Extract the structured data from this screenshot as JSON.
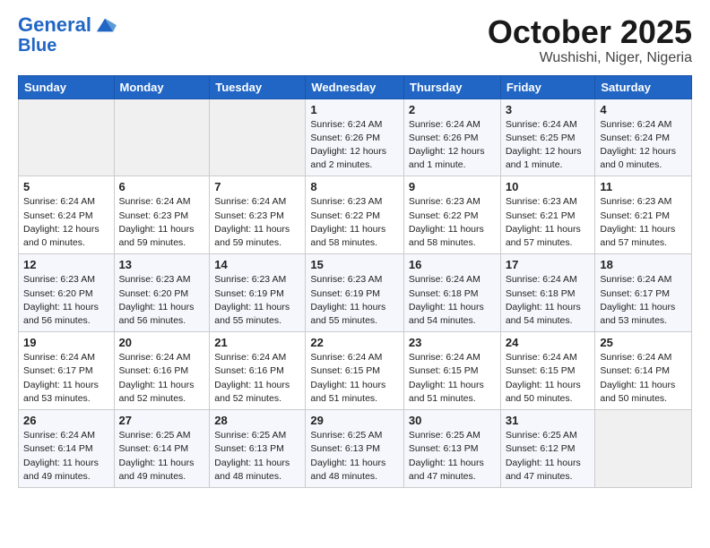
{
  "header": {
    "logo_line1": "General",
    "logo_line2": "Blue",
    "month_title": "October 2025",
    "location": "Wushishi, Niger, Nigeria"
  },
  "days_of_week": [
    "Sunday",
    "Monday",
    "Tuesday",
    "Wednesday",
    "Thursday",
    "Friday",
    "Saturday"
  ],
  "weeks": [
    [
      {
        "day": "",
        "info": ""
      },
      {
        "day": "",
        "info": ""
      },
      {
        "day": "",
        "info": ""
      },
      {
        "day": "1",
        "info": "Sunrise: 6:24 AM\nSunset: 6:26 PM\nDaylight: 12 hours\nand 2 minutes."
      },
      {
        "day": "2",
        "info": "Sunrise: 6:24 AM\nSunset: 6:26 PM\nDaylight: 12 hours\nand 1 minute."
      },
      {
        "day": "3",
        "info": "Sunrise: 6:24 AM\nSunset: 6:25 PM\nDaylight: 12 hours\nand 1 minute."
      },
      {
        "day": "4",
        "info": "Sunrise: 6:24 AM\nSunset: 6:24 PM\nDaylight: 12 hours\nand 0 minutes."
      }
    ],
    [
      {
        "day": "5",
        "info": "Sunrise: 6:24 AM\nSunset: 6:24 PM\nDaylight: 12 hours\nand 0 minutes."
      },
      {
        "day": "6",
        "info": "Sunrise: 6:24 AM\nSunset: 6:23 PM\nDaylight: 11 hours\nand 59 minutes."
      },
      {
        "day": "7",
        "info": "Sunrise: 6:24 AM\nSunset: 6:23 PM\nDaylight: 11 hours\nand 59 minutes."
      },
      {
        "day": "8",
        "info": "Sunrise: 6:23 AM\nSunset: 6:22 PM\nDaylight: 11 hours\nand 58 minutes."
      },
      {
        "day": "9",
        "info": "Sunrise: 6:23 AM\nSunset: 6:22 PM\nDaylight: 11 hours\nand 58 minutes."
      },
      {
        "day": "10",
        "info": "Sunrise: 6:23 AM\nSunset: 6:21 PM\nDaylight: 11 hours\nand 57 minutes."
      },
      {
        "day": "11",
        "info": "Sunrise: 6:23 AM\nSunset: 6:21 PM\nDaylight: 11 hours\nand 57 minutes."
      }
    ],
    [
      {
        "day": "12",
        "info": "Sunrise: 6:23 AM\nSunset: 6:20 PM\nDaylight: 11 hours\nand 56 minutes."
      },
      {
        "day": "13",
        "info": "Sunrise: 6:23 AM\nSunset: 6:20 PM\nDaylight: 11 hours\nand 56 minutes."
      },
      {
        "day": "14",
        "info": "Sunrise: 6:23 AM\nSunset: 6:19 PM\nDaylight: 11 hours\nand 55 minutes."
      },
      {
        "day": "15",
        "info": "Sunrise: 6:23 AM\nSunset: 6:19 PM\nDaylight: 11 hours\nand 55 minutes."
      },
      {
        "day": "16",
        "info": "Sunrise: 6:24 AM\nSunset: 6:18 PM\nDaylight: 11 hours\nand 54 minutes."
      },
      {
        "day": "17",
        "info": "Sunrise: 6:24 AM\nSunset: 6:18 PM\nDaylight: 11 hours\nand 54 minutes."
      },
      {
        "day": "18",
        "info": "Sunrise: 6:24 AM\nSunset: 6:17 PM\nDaylight: 11 hours\nand 53 minutes."
      }
    ],
    [
      {
        "day": "19",
        "info": "Sunrise: 6:24 AM\nSunset: 6:17 PM\nDaylight: 11 hours\nand 53 minutes."
      },
      {
        "day": "20",
        "info": "Sunrise: 6:24 AM\nSunset: 6:16 PM\nDaylight: 11 hours\nand 52 minutes."
      },
      {
        "day": "21",
        "info": "Sunrise: 6:24 AM\nSunset: 6:16 PM\nDaylight: 11 hours\nand 52 minutes."
      },
      {
        "day": "22",
        "info": "Sunrise: 6:24 AM\nSunset: 6:15 PM\nDaylight: 11 hours\nand 51 minutes."
      },
      {
        "day": "23",
        "info": "Sunrise: 6:24 AM\nSunset: 6:15 PM\nDaylight: 11 hours\nand 51 minutes."
      },
      {
        "day": "24",
        "info": "Sunrise: 6:24 AM\nSunset: 6:15 PM\nDaylight: 11 hours\nand 50 minutes."
      },
      {
        "day": "25",
        "info": "Sunrise: 6:24 AM\nSunset: 6:14 PM\nDaylight: 11 hours\nand 50 minutes."
      }
    ],
    [
      {
        "day": "26",
        "info": "Sunrise: 6:24 AM\nSunset: 6:14 PM\nDaylight: 11 hours\nand 49 minutes."
      },
      {
        "day": "27",
        "info": "Sunrise: 6:25 AM\nSunset: 6:14 PM\nDaylight: 11 hours\nand 49 minutes."
      },
      {
        "day": "28",
        "info": "Sunrise: 6:25 AM\nSunset: 6:13 PM\nDaylight: 11 hours\nand 48 minutes."
      },
      {
        "day": "29",
        "info": "Sunrise: 6:25 AM\nSunset: 6:13 PM\nDaylight: 11 hours\nand 48 minutes."
      },
      {
        "day": "30",
        "info": "Sunrise: 6:25 AM\nSunset: 6:13 PM\nDaylight: 11 hours\nand 47 minutes."
      },
      {
        "day": "31",
        "info": "Sunrise: 6:25 AM\nSunset: 6:12 PM\nDaylight: 11 hours\nand 47 minutes."
      },
      {
        "day": "",
        "info": ""
      }
    ]
  ]
}
